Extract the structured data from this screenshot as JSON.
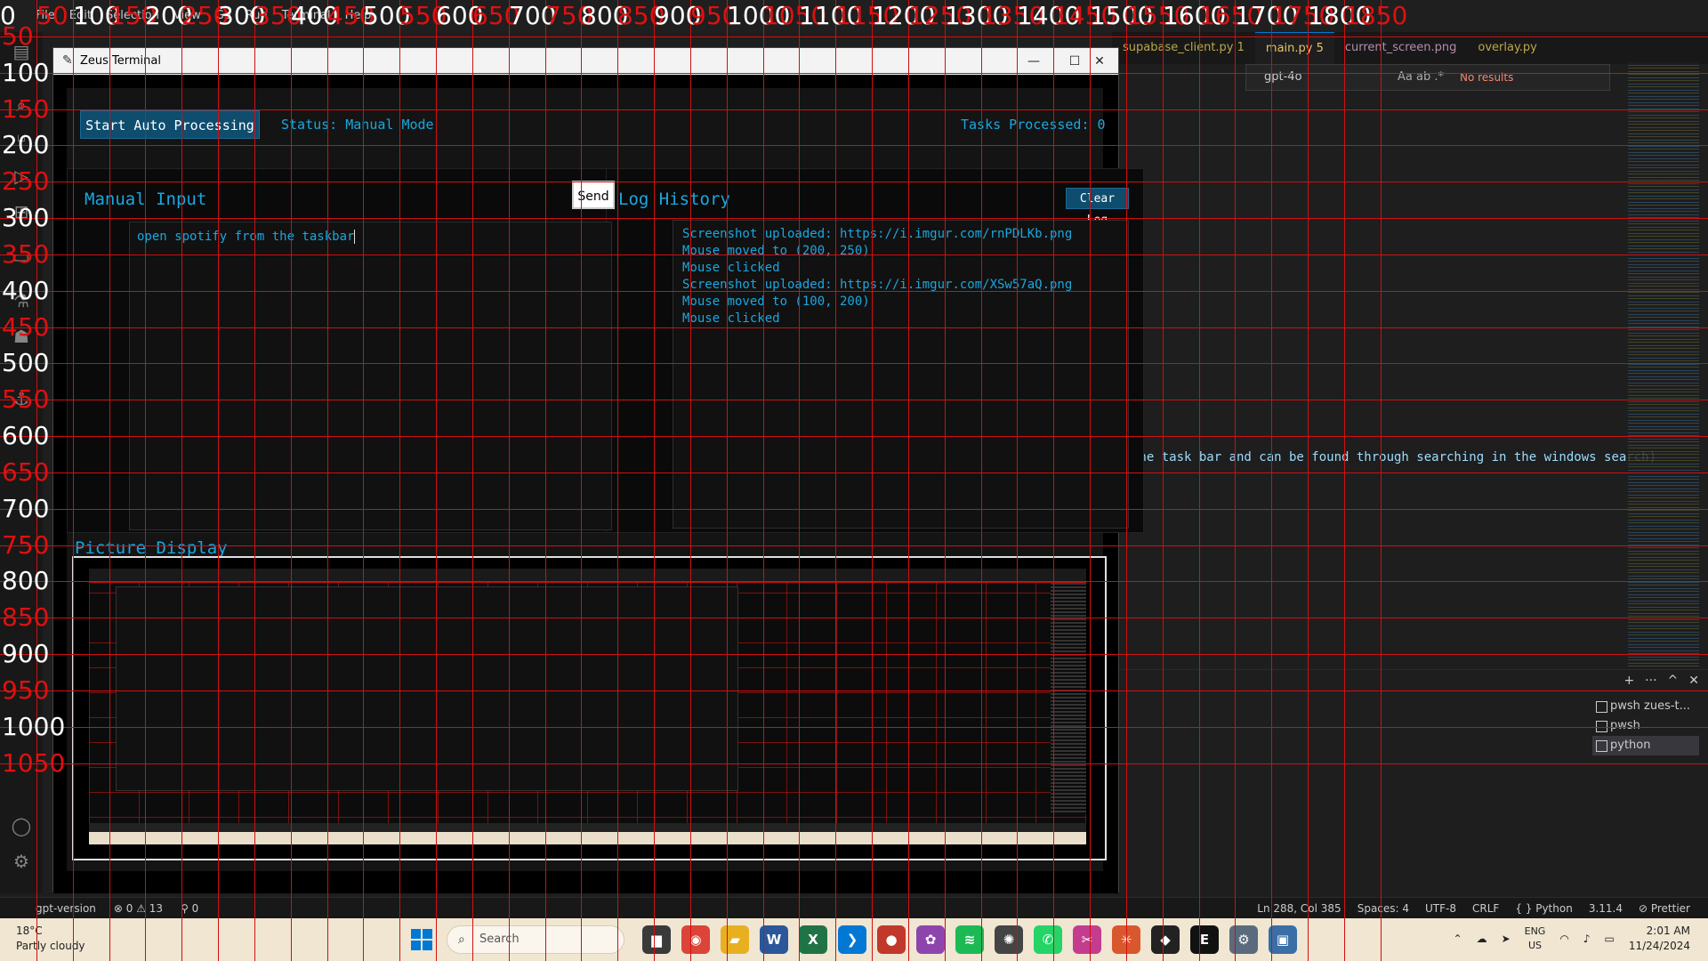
{
  "vscode": {
    "menu": [
      "File",
      "Edit",
      "Selection",
      "View",
      "Go",
      "Run",
      "Terminal",
      "Help"
    ],
    "tabs": [
      {
        "label": "supabase_client.py 1",
        "style": "normal"
      },
      {
        "label": "main.py 5",
        "style": "active"
      },
      {
        "label": "current_screen.png",
        "style": "purple"
      },
      {
        "label": "overlay.py",
        "style": "normal"
      }
    ],
    "find": {
      "query": "gpt-4o",
      "options": "Aa  ab  .*",
      "result": "No results"
    },
    "editor_line": "the task bar and can be found through searching in the windows search)",
    "terminals": [
      "pwsh zues-t...",
      "pwsh",
      "python"
    ],
    "status": {
      "branch": "gpt-version",
      "problems": "⊗ 0 ⚠ 13",
      "ports": "⚲ 0",
      "position": "Ln 288, Col 385",
      "spaces": "Spaces: 4",
      "encoding": "UTF-8",
      "eol": "CRLF",
      "language": "{ } Python",
      "version": "3.11.4",
      "formatter": "⊘ Prettier"
    }
  },
  "zeus": {
    "window_title": "Zeus Terminal",
    "start_button": "Start Auto Processing",
    "status": "Status: Manual Mode",
    "tasks": "Tasks Processed: 0",
    "manual_input_title": "Manual Input",
    "send_button": "Send",
    "input_value": "open spotify from the taskbar",
    "log_title": "Log History",
    "clear_button": "Clear Log",
    "log_lines": [
      "Screenshot uploaded: https://i.imgur.com/rnPDLKb.png",
      "Mouse moved to (200, 250)",
      "Mouse clicked",
      "Screenshot uploaded: https://i.imgur.com/XSw57aQ.png",
      "Mouse moved to (100, 200)",
      "Mouse clicked"
    ],
    "picture_title": "Picture Display"
  },
  "taskbar": {
    "weather_temp": "18°C",
    "weather_desc": "Partly cloudy",
    "search_placeholder": "Search",
    "lang_top": "ENG",
    "lang_bottom": "US",
    "time": "2:01 AM",
    "date": "11/24/2024",
    "apps": [
      {
        "name": "file-explorer",
        "glyph": "▆",
        "color": "#3a3a3a"
      },
      {
        "name": "chrome",
        "glyph": "◉",
        "color": "#db4437"
      },
      {
        "name": "folder",
        "glyph": "▰",
        "color": "#e8b021"
      },
      {
        "name": "word",
        "glyph": "W",
        "color": "#2b579a"
      },
      {
        "name": "excel",
        "glyph": "X",
        "color": "#217346"
      },
      {
        "name": "vscode",
        "glyph": "❯",
        "color": "#0078d4"
      },
      {
        "name": "davinci",
        "glyph": "●",
        "color": "#c0392b"
      },
      {
        "name": "copilot",
        "glyph": "✿",
        "color": "#8e44ad"
      },
      {
        "name": "spotify",
        "glyph": "≋",
        "color": "#1db954"
      },
      {
        "name": "chatgpt",
        "glyph": "✺",
        "color": "#444444"
      },
      {
        "name": "whatsapp",
        "glyph": "✆",
        "color": "#25d366"
      },
      {
        "name": "snipping",
        "glyph": "✂",
        "color": "#c43c8e"
      },
      {
        "name": "claude",
        "glyph": "✳",
        "color": "#d9572c"
      },
      {
        "name": "unity",
        "glyph": "◆",
        "color": "#222222"
      },
      {
        "name": "epic-games",
        "glyph": "E",
        "color": "#111111"
      },
      {
        "name": "settings",
        "glyph": "⚙",
        "color": "#5a6b7d"
      },
      {
        "name": "python",
        "glyph": "▣",
        "color": "#3b6ea5"
      }
    ]
  },
  "ruler": {
    "top_labels": [
      "0",
      "50",
      "100",
      "150",
      "200",
      "250",
      "300",
      "350",
      "400",
      "450",
      "500",
      "550",
      "600",
      "650",
      "700",
      "750",
      "800",
      "850",
      "900",
      "950",
      "1000",
      "1050",
      "1100",
      "1150",
      "1200",
      "1250",
      "1300",
      "1350",
      "1400",
      "1450",
      "1500",
      "1550",
      "1600",
      "1650",
      "1700",
      "1750",
      "1800",
      "1850"
    ],
    "left_labels": [
      "50",
      "100",
      "150",
      "200",
      "250",
      "300",
      "350",
      "400",
      "450",
      "500",
      "550",
      "600",
      "650",
      "700",
      "750",
      "800",
      "850",
      "900",
      "950",
      "1000",
      "1050"
    ]
  }
}
